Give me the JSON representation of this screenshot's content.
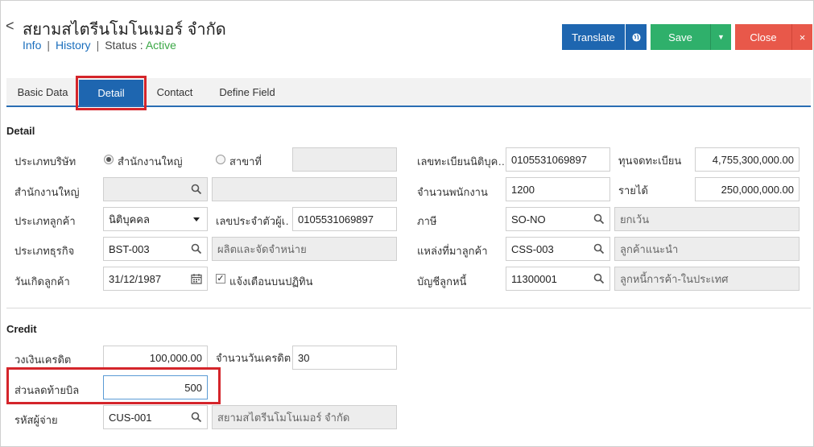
{
  "header": {
    "back_glyph": "<",
    "title": "สยามสไตรีนโมโนเมอร์ จำกัด",
    "links": {
      "info": "Info",
      "history": "History"
    },
    "separator": "|",
    "status_label": "Status",
    "status_colon": ":",
    "status_value": "Active"
  },
  "toolbar": {
    "translate": "Translate",
    "translate_icon": "globe-icon",
    "save": "Save",
    "save_caret": "▼",
    "close": "Close",
    "close_x": "×"
  },
  "tabs": [
    "Basic Data",
    "Detail",
    "Contact",
    "Define Field"
  ],
  "detail": {
    "section_title": "Detail",
    "company_type_label": "ประเภทบริษัท",
    "company_type_options": [
      "สำนักงานใหญ่",
      "สาขาที่"
    ],
    "company_type_selected": "สำนักงานใหญ่",
    "branch_no": "",
    "head_office_label": "สำนักงานใหญ่",
    "head_office_code": "",
    "head_office_name": "",
    "customer_type_label": "ประเภทลูกค้า",
    "customer_type_value": "นิติบุคคล",
    "tax_id_label": "เลขประจำตัวผู้เ…",
    "tax_id_value": "0105531069897",
    "business_type_label": "ประเภทธุรกิจ",
    "business_type_code": "BST-003",
    "business_type_name": "ผลิตและจัดจำหน่าย",
    "birthday_label": "วันเกิดลูกค้า",
    "birthday_value": "31/12/1987",
    "notify_label": "แจ้งเตือนบนปฏิทิน",
    "notify_checked": true,
    "reg_no_label": "เลขทะเบียนนิติบุค…",
    "reg_no_value": "0105531069897",
    "capital_label": "ทุนจดทะเบียน",
    "capital_value": "4,755,300,000.00",
    "employees_label": "จำนวนพนักงาน",
    "employees_value": "1200",
    "income_label": "รายได้",
    "income_value": "250,000,000.00",
    "tax_label": "ภาษี",
    "tax_code": "SO-NO",
    "tax_name": "ยกเว้น",
    "source_label": "แหล่งที่มาลูกค้า",
    "source_code": "CSS-003",
    "source_name": "ลูกค้าแนะนำ",
    "ar_label": "บัญชีลูกหนี้",
    "ar_code": "11300001",
    "ar_name": "ลูกหนี้การค้า-ในประเทศ"
  },
  "credit": {
    "section_title": "Credit",
    "limit_label": "วงเงินเครดิต",
    "limit_value": "100,000.00",
    "days_label": "จำนวนวันเครดิต",
    "days_value": "30",
    "discount_label": "ส่วนลดท้ายบิล",
    "discount_value": "500",
    "seller_label": "รหัสผู้จ่าย",
    "seller_code": "CUS-001",
    "seller_name": "สยามสไตรีนโมโนเมอร์ จำกัด"
  },
  "colors": {
    "primary": "#1e66b0",
    "save": "#2fb06b",
    "close": "#e8584a",
    "active_status": "#3aa745",
    "highlight": "#d4252b"
  }
}
